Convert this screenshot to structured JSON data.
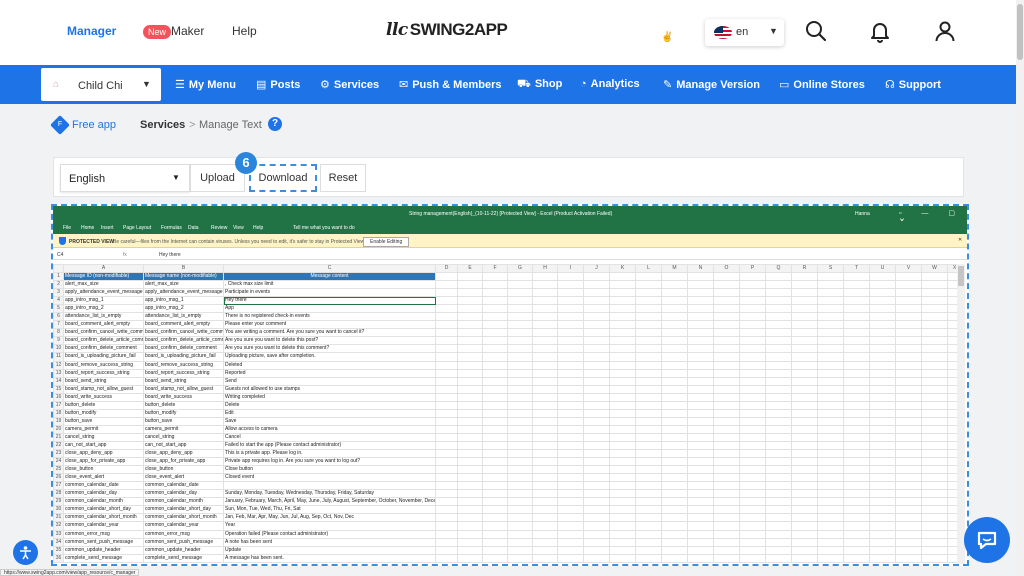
{
  "topbar": {
    "nav": {
      "manager": "Manager",
      "new_badge": "New",
      "maker": "Maker",
      "help": "Help"
    },
    "logo": {
      "mark": "llc",
      "text": "SWING2APP"
    },
    "peace_glyph": "✌",
    "language": {
      "flag": "us-flag-icon",
      "value": "en"
    },
    "icons": [
      "search-icon",
      "bell-icon",
      "user-icon"
    ]
  },
  "bluenav": {
    "app_selector": "Child Chi",
    "items": [
      {
        "icon": "☰",
        "label": "My Menu"
      },
      {
        "icon": "▤",
        "label": "Posts"
      },
      {
        "icon": "⚙",
        "label": "Services"
      },
      {
        "icon": "✉",
        "label": "Push & Members"
      },
      {
        "icon": "⛟",
        "label": "Shop"
      },
      {
        "icon": "◔",
        "label": "Analytics"
      },
      {
        "icon": "✎",
        "label": "Manage Version"
      },
      {
        "icon": "▭",
        "label": "Online Stores"
      },
      {
        "icon": "☊",
        "label": "Support"
      }
    ]
  },
  "breadcrumb": {
    "badge": "F",
    "free_app": "Free app",
    "services": "Services",
    "separator": ">",
    "manage_text": "Manage Text",
    "help_icon": "?"
  },
  "toolbar": {
    "language": "English",
    "upload": "Upload",
    "download": "Download",
    "reset": "Reset",
    "step_number": "6"
  },
  "excel": {
    "title": "String management(English)_(10-11-22) [Protected View] - Excel (Product Activation Failed)",
    "user": "Hanna",
    "window_controls": "▫ — ▢ ✕",
    "ribbon_tabs": [
      "File",
      "Home",
      "Insert",
      "Page Layout",
      "Formulas",
      "Data",
      "Review",
      "View",
      "Help",
      "Tell me what you want to do"
    ],
    "protected_view": {
      "label": "PROTECTED VIEW",
      "message": "Be careful—files from the Internet can contain viruses. Unless you need to edit, it's safer to stay in Protected View.",
      "enable_button": "Enable Editing"
    },
    "formula_bar": {
      "cell": "C4",
      "fx": "fx",
      "value": "Hey there"
    },
    "columns": [
      "A",
      "B",
      "C",
      "D",
      "E",
      "F",
      "G",
      "H",
      "I",
      "J",
      "K",
      "L",
      "M",
      "N",
      "O",
      "P",
      "Q",
      "R",
      "S",
      "T",
      "U",
      "V",
      "W",
      "X"
    ],
    "headers": [
      "Message ID (non-modifiable)",
      "Message name (non-modifiable)",
      "Message content"
    ],
    "rows": [
      [
        "alert_max_size",
        "alert_max_size",
        ", Check max size limit"
      ],
      [
        "apply_attendance_event_message",
        "apply_attendance_event_message",
        "Participate in events"
      ],
      [
        "app_intro_msg_1",
        "app_intro_msg_1",
        "Hey there"
      ],
      [
        "app_intro_msg_2",
        "app_intro_msg_2",
        "App"
      ],
      [
        "attendance_list_is_empty",
        "attendance_list_is_empty",
        "There is no registered check-in events"
      ],
      [
        "board_comment_alert_empty",
        "board_comment_alert_empty",
        "Please enter your comment"
      ],
      [
        "board_confirm_cancel_write_comment",
        "board_confirm_cancel_write_comment",
        "You are writing a comment. Are you sure you want to cancel it?"
      ],
      [
        "board_confirm_delete_article_comment",
        "board_confirm_delete_article_comment",
        "Are you sure you want to delete this post?"
      ],
      [
        "board_confirm_delete_comment",
        "board_confirm_delete_comment",
        "Are you sure you want to delete this comment?"
      ],
      [
        "board_is_uploading_picture_fail",
        "board_is_uploading_picture_fail",
        "Uploading picture, save after completion."
      ],
      [
        "board_remove_success_string",
        "board_remove_success_string",
        "Deleted"
      ],
      [
        "board_report_success_string",
        "board_report_success_string",
        "Reported"
      ],
      [
        "board_send_string",
        "board_send_string",
        "Send"
      ],
      [
        "board_stamp_not_allow_guest",
        "board_stamp_not_allow_guest",
        "Guests not allowed to use stamps"
      ],
      [
        "board_write_success",
        "board_write_success",
        "Writing completed"
      ],
      [
        "button_delete",
        "button_delete",
        "Delete"
      ],
      [
        "button_modify",
        "button_modify",
        "Edit"
      ],
      [
        "button_save",
        "button_save",
        "Save"
      ],
      [
        "camera_permit",
        "camera_permit",
        "Allow access to camera"
      ],
      [
        "cancel_string",
        "cancel_string",
        "Cancel"
      ],
      [
        "can_not_start_app",
        "can_not_start_app",
        "Failed to start the app (Please contact administrator)"
      ],
      [
        "close_app_deny_app",
        "close_app_deny_app",
        "This is a private app. Please log in."
      ],
      [
        "close_app_for_private_app",
        "close_app_for_private_app",
        "Private app requires log in. Are you sure you want to log out?"
      ],
      [
        "close_button",
        "close_button",
        "Close button"
      ],
      [
        "close_event_alert",
        "close_event_alert",
        "Closed event"
      ],
      [
        "common_calendar_date",
        "common_calendar_date",
        ""
      ],
      [
        "common_calendar_day",
        "common_calendar_day",
        "Sunday, Monday, Tuesday, Wednesday, Thursday, Friday, Saturday"
      ],
      [
        "common_calendar_month",
        "common_calendar_month",
        "January, February, March, April, May, June, July, August, September, October, November, December"
      ],
      [
        "common_calendar_short_day",
        "common_calendar_short_day",
        "Sun, Mon, Tue, Wed, Thu, Fri, Sat"
      ],
      [
        "common_calendar_short_month",
        "common_calendar_short_month",
        "Jan, Feb, Mar, Apr, May, Jun, Jul, Aug, Sep, Oct, Nov, Dec"
      ],
      [
        "common_calendar_year",
        "common_calendar_year",
        "Year"
      ],
      [
        "common_error_msg",
        "common_error_msg",
        "Operation failed (Please contact administrator)"
      ],
      [
        "common_sent_push_message",
        "common_sent_push_message",
        "A note has been sent"
      ],
      [
        "common_update_header",
        "common_update_header",
        "Update"
      ],
      [
        "complete_send_message",
        "complete_send_message",
        "A message has been sent."
      ]
    ]
  },
  "status_url": "https://www.swing2app.com/view/app_resource/c_manager",
  "colors": {
    "brand_blue": "#1e74e6",
    "excel_green": "#217346",
    "header_blue": "#2e75b6",
    "badge_red": "#f2545b"
  }
}
